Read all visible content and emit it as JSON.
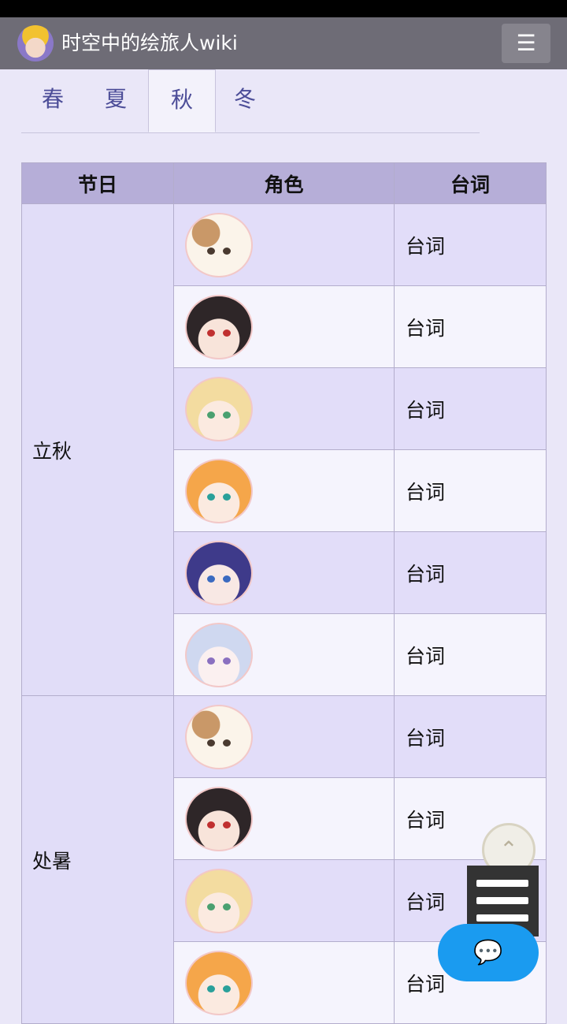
{
  "header": {
    "title": "时空中的绘旅人wiki",
    "menu_icon": "list-icon"
  },
  "tabs": [
    "春",
    "夏",
    "秋",
    "冬"
  ],
  "active_tab": "秋",
  "table": {
    "headers": [
      "节日",
      "角色",
      "台词"
    ],
    "festivals": [
      {
        "name": "立秋",
        "rows": [
          {
            "avatar": "cat-avatar",
            "line": "台词"
          },
          {
            "avatar": "dark-hair-avatar",
            "line": "台词"
          },
          {
            "avatar": "blonde-hair-avatar",
            "line": "台词"
          },
          {
            "avatar": "orange-hair-avatar",
            "line": "台词"
          },
          {
            "avatar": "purple-hair-glasses-avatar",
            "line": "台词"
          },
          {
            "avatar": "silver-hair-avatar",
            "line": "台词"
          }
        ]
      },
      {
        "name": "处暑",
        "rows": [
          {
            "avatar": "cat-avatar",
            "line": "台词"
          },
          {
            "avatar": "dark-hair-avatar",
            "line": "台词"
          },
          {
            "avatar": "blonde-hair-avatar",
            "line": "台词"
          },
          {
            "avatar": "orange-hair-avatar",
            "line": "台词"
          }
        ]
      }
    ]
  },
  "colors": {
    "header_bg": "#6e6c76",
    "accent": "#4c4d98",
    "chat_button": "#1a9bf0"
  }
}
